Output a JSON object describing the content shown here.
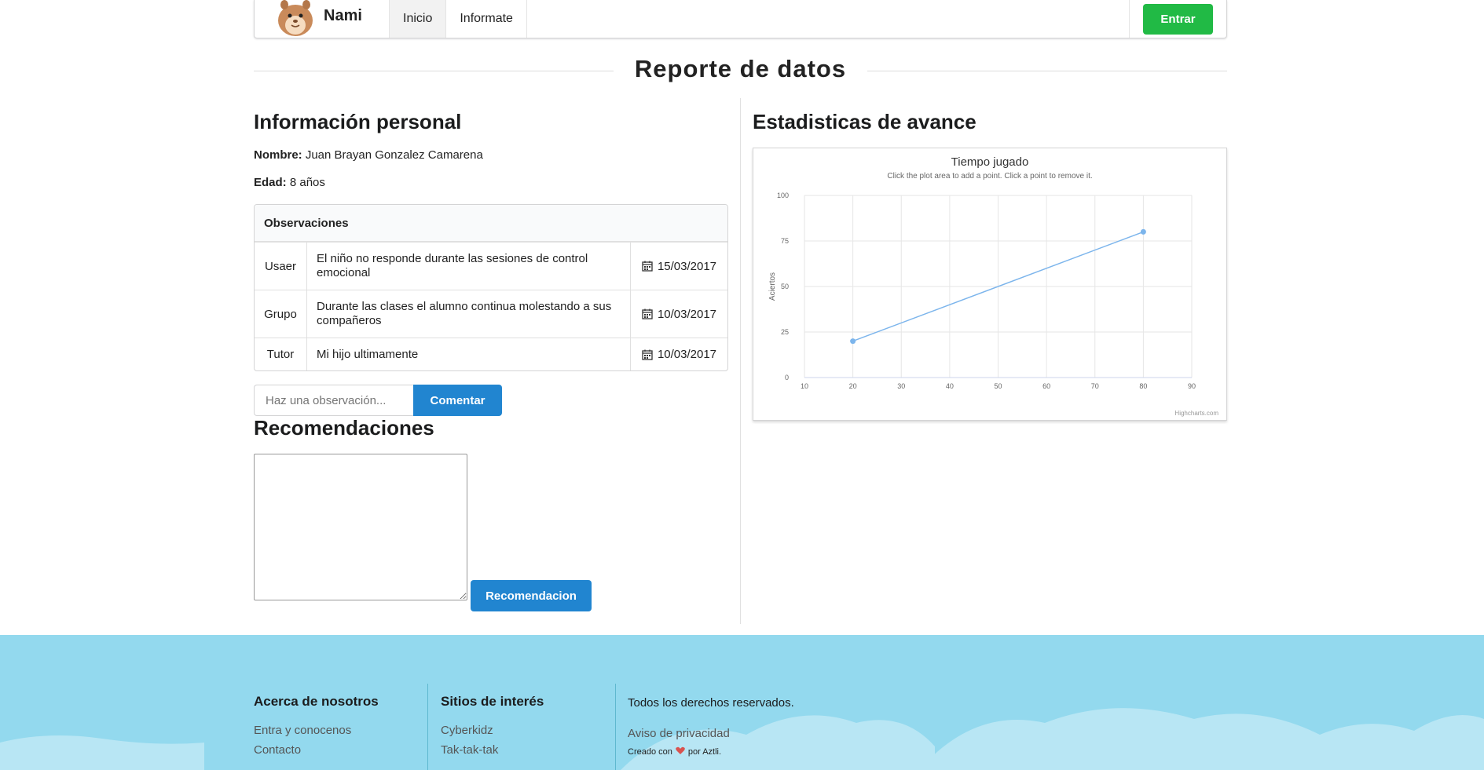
{
  "nav": {
    "brand": "Nami",
    "items": [
      {
        "label": "Inicio",
        "active": true
      },
      {
        "label": "Informate",
        "active": false
      }
    ],
    "login_label": "Entrar"
  },
  "page": {
    "title": "Reporte de datos"
  },
  "personal": {
    "title": "Información personal",
    "name_label": "Nombre:",
    "name_value": "Juan Brayan Gonzalez Camarena",
    "age_label": "Edad:",
    "age_value": "8 años"
  },
  "observations": {
    "header": "Observaciones",
    "rows": [
      {
        "author": "Usaer",
        "text": "El niño no responde durante las sesiones de control emocional",
        "date": "15/03/2017"
      },
      {
        "author": "Grupo",
        "text": "Durante las clases el alumno continua molestando a sus compañeros",
        "date": "10/03/2017"
      },
      {
        "author": "Tutor",
        "text": "Mi hijo ultimamente",
        "date": "10/03/2017"
      }
    ],
    "input_placeholder": "Haz una observación...",
    "comment_label": "Comentar"
  },
  "recommendations": {
    "title": "Recomendaciones",
    "button_label": "Recomendacion"
  },
  "stats": {
    "title": "Estadisticas de avance"
  },
  "chart_data": {
    "type": "line",
    "title": "Tiempo jugado",
    "subtitle": "Click the plot area to add a point. Click a point to remove it.",
    "xlabel": "",
    "ylabel": "Aciertos",
    "xlim": [
      10,
      90
    ],
    "ylim": [
      0,
      100
    ],
    "xticks": [
      10,
      20,
      30,
      40,
      50,
      60,
      70,
      80,
      90
    ],
    "yticks": [
      0,
      25,
      50,
      75,
      100
    ],
    "grid": true,
    "credit": "Highcharts.com",
    "series": [
      {
        "x": [
          20,
          80
        ],
        "y": [
          20,
          80
        ],
        "color": "#7cb5ec"
      }
    ]
  },
  "footer": {
    "about_title": "Acerca de nosotros",
    "about_links": [
      "Entra y conocenos",
      "Contacto"
    ],
    "sites_title": "Sitios de interés",
    "sites_links": [
      "Cyberkidz",
      "Tak-tak-tak"
    ],
    "rights": "Todos los derechos reservados.",
    "privacy": "Aviso de privacidad",
    "made_prefix": "Creado con",
    "made_suffix": "por Aztli."
  },
  "colors": {
    "green": "#21ba45",
    "blue": "#2185d0",
    "footer_bg": "#93d9ee",
    "series": "#7cb5ec"
  }
}
